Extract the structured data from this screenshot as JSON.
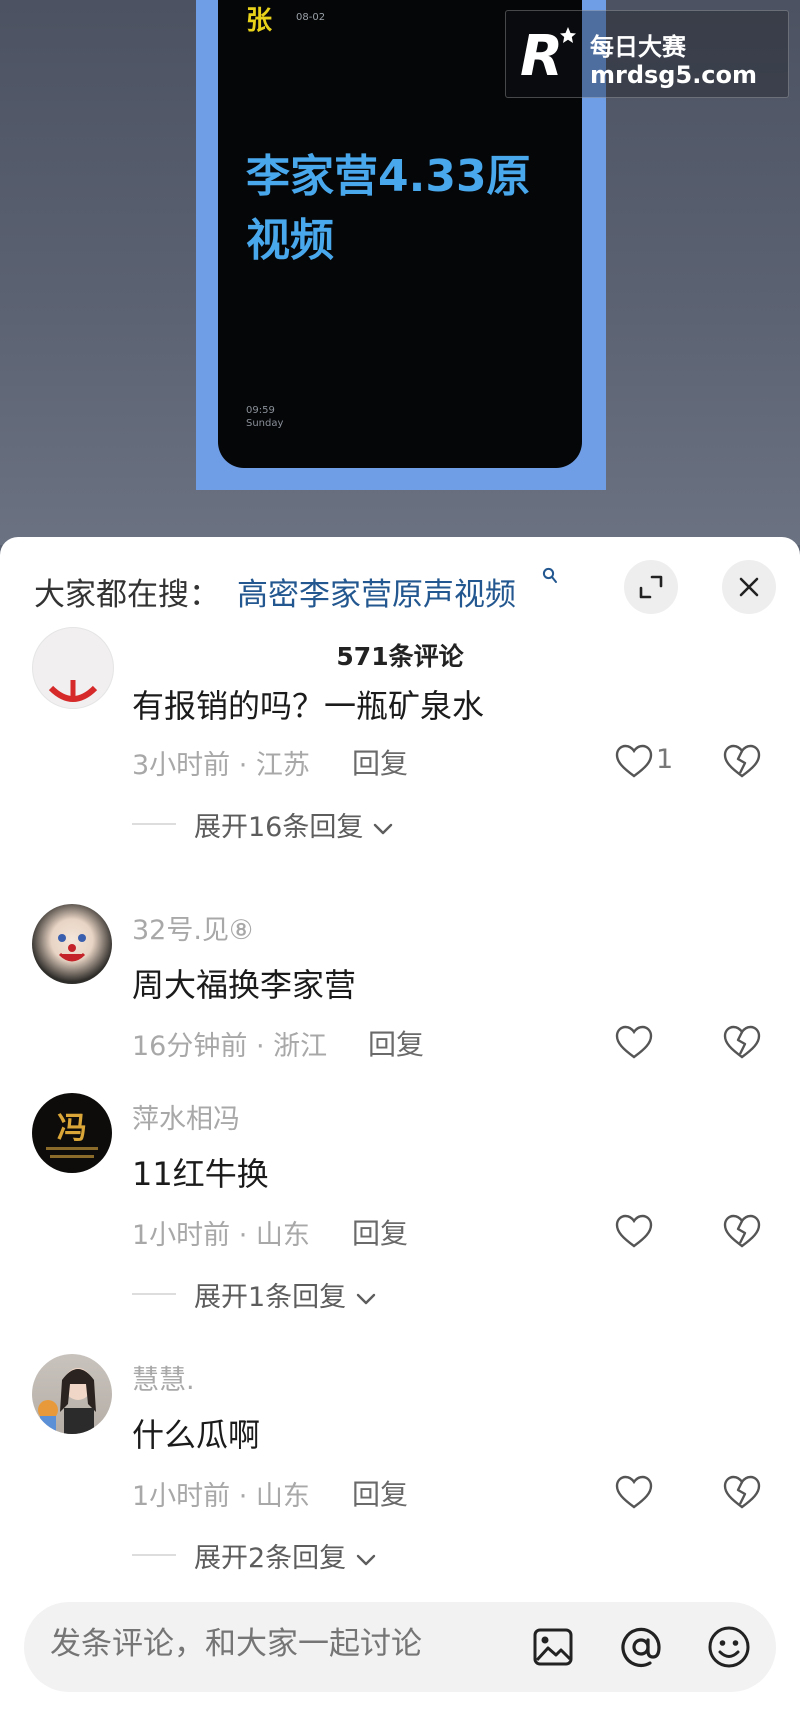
{
  "video": {
    "screen_glyph": "张",
    "screen_date": "08-02",
    "screen_title": "李家营4.33原视频",
    "screen_time": "09:59",
    "screen_day": "Sunday",
    "frame_color": "#6f9de6",
    "title_color": "#49a7ec"
  },
  "watermark": {
    "logo_letter": "R",
    "name": "每日大赛",
    "url": "mrdsg5.com"
  },
  "panel": {
    "search_prefix": "大家都在搜：",
    "search_term": "高密李家营原声视频",
    "search_term_color": "#23578f",
    "comment_count_label": "571条评论",
    "icons": [
      "search-icon",
      "expand-icon",
      "close-icon"
    ]
  },
  "comments": [
    {
      "username": "",
      "text": "有报销的吗？一瓶矿泉水",
      "meta": "3小时前 · 江苏",
      "reply_label": "回复",
      "likes": "1",
      "expand_label": "展开16条回复"
    },
    {
      "username": "32号.见⑧",
      "text": "周大福换李家营",
      "meta": "16分钟前 · 浙江",
      "reply_label": "回复",
      "likes": ""
    },
    {
      "username": "萍水相冯",
      "text": "11红牛换",
      "meta": "1小时前 · 山东",
      "reply_label": "回复",
      "likes": "",
      "expand_label": "展开1条回复",
      "avatar_glyph": "冯"
    },
    {
      "username": "慧慧.",
      "text": "什么瓜啊",
      "meta": "1小时前 · 山东",
      "reply_label": "回复",
      "likes": "",
      "expand_label": "展开2条回复"
    }
  ],
  "input_bar": {
    "placeholder": "发条评论，和大家一起讨论",
    "icons": [
      "image-icon",
      "mention-icon",
      "emoji-icon"
    ]
  }
}
